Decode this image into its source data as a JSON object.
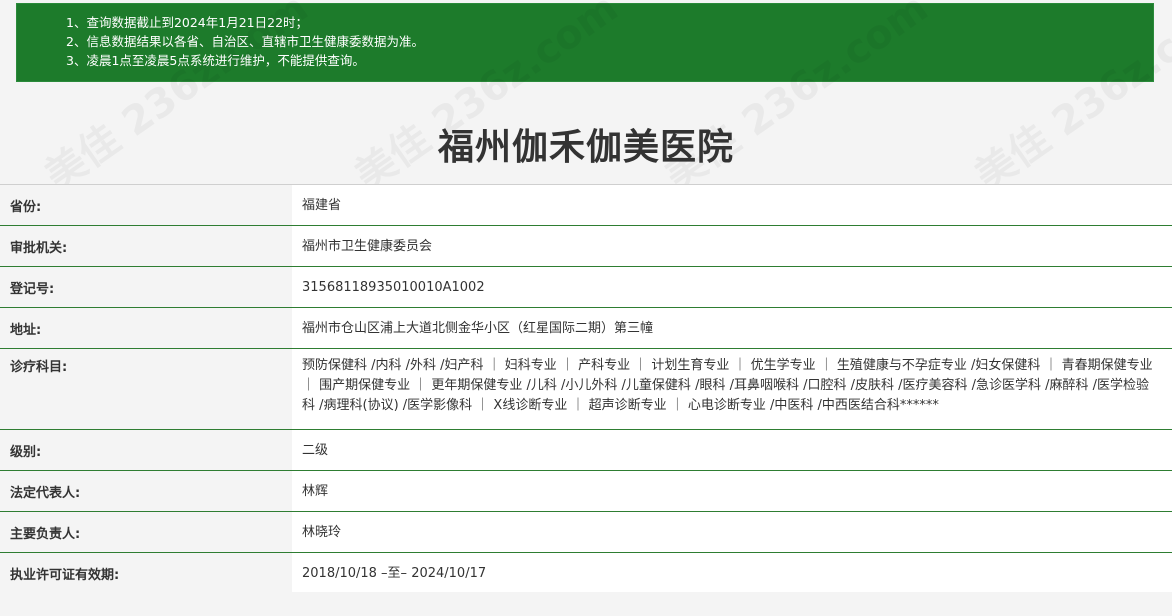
{
  "notice": {
    "line1": "1、查询数据截止到2024年1月21日22时；",
    "line2": "2、信息数据结果以各省、自治区、直辖市卫生健康委数据为准。",
    "line3": "3、凌晨1点至凌晨5点系统进行维护，不能提供查询。"
  },
  "title": "福州伽禾伽美医院",
  "rows": [
    {
      "label": "省份:",
      "value": "福建省"
    },
    {
      "label": "审批机关:",
      "value": "福州市卫生健康委员会"
    },
    {
      "label": "登记号:",
      "value": "31568118935010010A1002"
    },
    {
      "label": "地址:",
      "value": "福州市仓山区浦上大道北侧金华小区（红星国际二期）第三幢"
    },
    {
      "label": "诊疗科目:",
      "value": "预防保健科 /内科 /外科 /妇产科 ｜ 妇科专业 ｜ 产科专业 ｜ 计划生育专业 ｜ 优生学专业 ｜ 生殖健康与不孕症专业 /妇女保健科 ｜ 青春期保健专业 ｜ 围产期保健专业 ｜ 更年期保健专业 /儿科 /小儿外科 /儿童保健科 /眼科 /耳鼻咽喉科 /口腔科 /皮肤科 /医疗美容科 /急诊医学科 /麻醉科 /医学检验科 /病理科(协议) /医学影像科 ｜ X线诊断专业 ｜ 超声诊断专业 ｜ 心电诊断专业 /中医科 /中西医结合科******"
    },
    {
      "label": "级别:",
      "value": "二级"
    },
    {
      "label": "法定代表人:",
      "value": "林辉"
    },
    {
      "label": "主要负责人:",
      "value": "林晓玲"
    },
    {
      "label": "执业许可证有效期:",
      "value": "2018/10/18 –至– 2024/10/17"
    }
  ],
  "watermark_text": "美佳 236z.com"
}
